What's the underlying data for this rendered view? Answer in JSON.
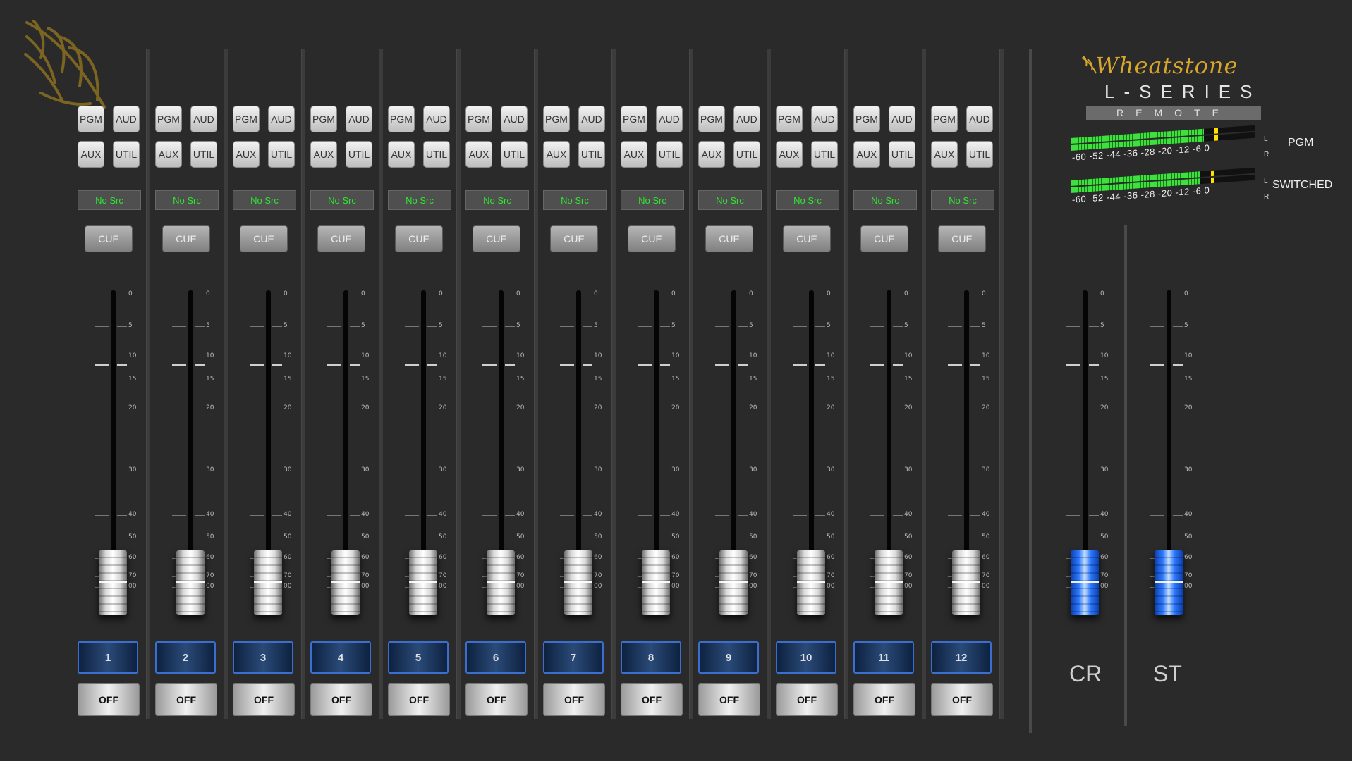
{
  "brand": {
    "name": "Wheatstone",
    "series": "L-SERIES",
    "subtitle": "REMOTE"
  },
  "meters": [
    {
      "name": "PGM",
      "scale": "-60 -52 -44 -36 -28 -20 -12 -6  0",
      "left": "L",
      "right": "R",
      "level": 0.72,
      "peak": 0.78
    },
    {
      "name": "SWITCHED",
      "scale": "-60 -52 -44 -36 -28 -20 -12 -6  0",
      "left": "L",
      "right": "R",
      "level": 0.7,
      "peak": 0.76
    }
  ],
  "fader_scale": [
    "0",
    "5",
    "10",
    "15",
    "20",
    "30",
    "40",
    "50",
    "60",
    "70",
    "00"
  ],
  "channels": [
    {
      "number": "1",
      "source": "No Src",
      "pgm": "PGM",
      "aud": "AUD",
      "aux": "AUX",
      "util": "UTIL",
      "cue": "CUE",
      "state": "OFF",
      "fader_level": 0.02
    },
    {
      "number": "2",
      "source": "No Src",
      "pgm": "PGM",
      "aud": "AUD",
      "aux": "AUX",
      "util": "UTIL",
      "cue": "CUE",
      "state": "OFF",
      "fader_level": 0.02
    },
    {
      "number": "3",
      "source": "No Src",
      "pgm": "PGM",
      "aud": "AUD",
      "aux": "AUX",
      "util": "UTIL",
      "cue": "CUE",
      "state": "OFF",
      "fader_level": 0.02
    },
    {
      "number": "4",
      "source": "No Src",
      "pgm": "PGM",
      "aud": "AUD",
      "aux": "AUX",
      "util": "UTIL",
      "cue": "CUE",
      "state": "OFF",
      "fader_level": 0.02
    },
    {
      "number": "5",
      "source": "No Src",
      "pgm": "PGM",
      "aud": "AUD",
      "aux": "AUX",
      "util": "UTIL",
      "cue": "CUE",
      "state": "OFF",
      "fader_level": 0.02
    },
    {
      "number": "6",
      "source": "No Src",
      "pgm": "PGM",
      "aud": "AUD",
      "aux": "AUX",
      "util": "UTIL",
      "cue": "CUE",
      "state": "OFF",
      "fader_level": 0.02
    },
    {
      "number": "7",
      "source": "No Src",
      "pgm": "PGM",
      "aud": "AUD",
      "aux": "AUX",
      "util": "UTIL",
      "cue": "CUE",
      "state": "OFF",
      "fader_level": 0.02
    },
    {
      "number": "8",
      "source": "No Src",
      "pgm": "PGM",
      "aud": "AUD",
      "aux": "AUX",
      "util": "UTIL",
      "cue": "CUE",
      "state": "OFF",
      "fader_level": 0.02
    },
    {
      "number": "9",
      "source": "No Src",
      "pgm": "PGM",
      "aud": "AUD",
      "aux": "AUX",
      "util": "UTIL",
      "cue": "CUE",
      "state": "OFF",
      "fader_level": 0.02
    },
    {
      "number": "10",
      "source": "No Src",
      "pgm": "PGM",
      "aud": "AUD",
      "aux": "AUX",
      "util": "UTIL",
      "cue": "CUE",
      "state": "OFF",
      "fader_level": 0.02
    },
    {
      "number": "11",
      "source": "No Src",
      "pgm": "PGM",
      "aud": "AUD",
      "aux": "AUX",
      "util": "UTIL",
      "cue": "CUE",
      "state": "OFF",
      "fader_level": 0.02
    },
    {
      "number": "12",
      "source": "No Src",
      "pgm": "PGM",
      "aud": "AUD",
      "aux": "AUX",
      "util": "UTIL",
      "cue": "CUE",
      "state": "OFF",
      "fader_level": 0.02
    }
  ],
  "masters": [
    {
      "label": "CR",
      "fader_level": 0.02
    },
    {
      "label": "ST",
      "fader_level": 0.02
    }
  ],
  "colors": {
    "background": "#2a2a2a",
    "source_text": "#2fe52f",
    "brand_gold": "#d8a62a",
    "channel_border": "#3a6fd0",
    "master_fader": "#2f7cff"
  }
}
